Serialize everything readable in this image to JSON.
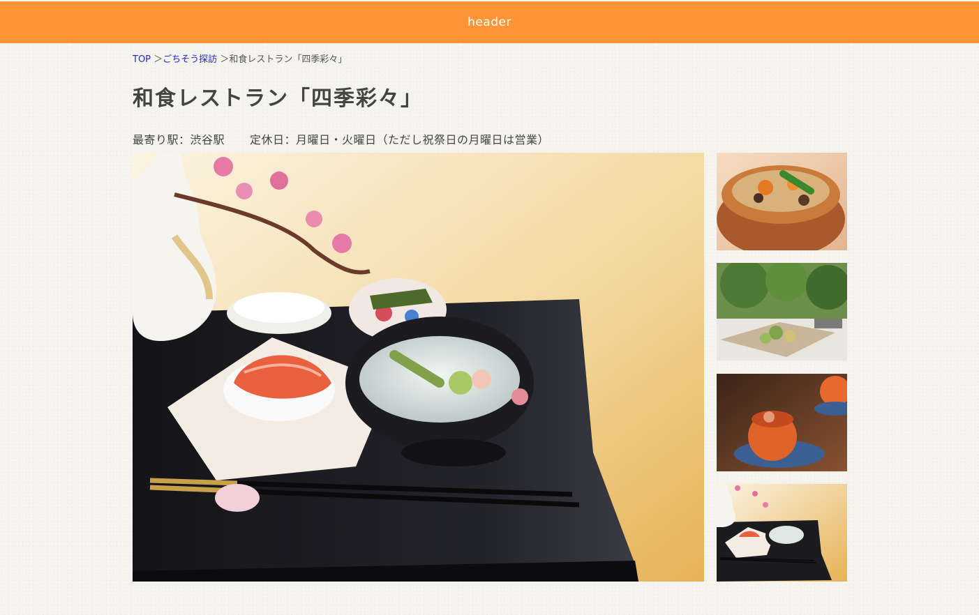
{
  "header": {
    "label": "header"
  },
  "breadcrumb": {
    "items": [
      {
        "label": "TOP",
        "link": true
      },
      {
        "label": "ごちそう探訪",
        "link": true
      },
      {
        "label": "和食レストラン「四季彩々」",
        "link": false
      }
    ],
    "separator": ">"
  },
  "restaurant": {
    "title": "和食レストラン「四季彩々」",
    "nearest_station": "最寄り駅：渋谷駅",
    "closed_days": "定休日：月曜日・火曜日（ただし祝祭日の月曜日は営業）"
  },
  "gallery": {
    "main_image": "kaiseki-tray-photo",
    "thumbnails": [
      "takikomi-rice-pot-photo",
      "tempura-platter-photo",
      "persimmon-dish-photo",
      "kaiseki-tray-small-photo"
    ]
  },
  "colors": {
    "header_bg": "#ff9436",
    "link": "#2525cc",
    "text": "#444444",
    "page_bg": "#f6f4ee"
  }
}
